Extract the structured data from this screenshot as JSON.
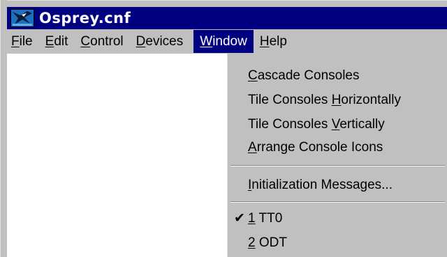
{
  "window": {
    "title": "Osprey.cnf",
    "icon": "osprey-app-icon"
  },
  "menubar": {
    "items": [
      {
        "pre": "",
        "key": "F",
        "post": "ile"
      },
      {
        "pre": "",
        "key": "E",
        "post": "dit"
      },
      {
        "pre": "",
        "key": "C",
        "post": "ontrol"
      },
      {
        "pre": "",
        "key": "D",
        "post": "evices"
      },
      {
        "pre": "",
        "key": "W",
        "post": "indow"
      },
      {
        "pre": "",
        "key": "H",
        "post": "elp"
      }
    ],
    "active_index": 4
  },
  "window_menu": {
    "items": [
      {
        "pre": "",
        "key": "C",
        "post": "ascade Consoles"
      },
      {
        "pre": "Tile Consoles ",
        "key": "H",
        "post": "orizontally"
      },
      {
        "pre": "Tile Consoles ",
        "key": "V",
        "post": "ertically"
      },
      {
        "pre": "",
        "key": "A",
        "post": "rrange Console Icons"
      },
      {
        "pre": "",
        "key": "I",
        "post": "nitialization Messages..."
      },
      {
        "pre": "",
        "key": "1",
        "post": " TT0"
      },
      {
        "pre": "",
        "key": "2",
        "post": " ODT"
      }
    ],
    "checked_index": 5,
    "check_glyph": "✔"
  },
  "colors": {
    "titlebar": "#000080",
    "menu_face": "#c0c0c0",
    "highlight": "#000080"
  }
}
